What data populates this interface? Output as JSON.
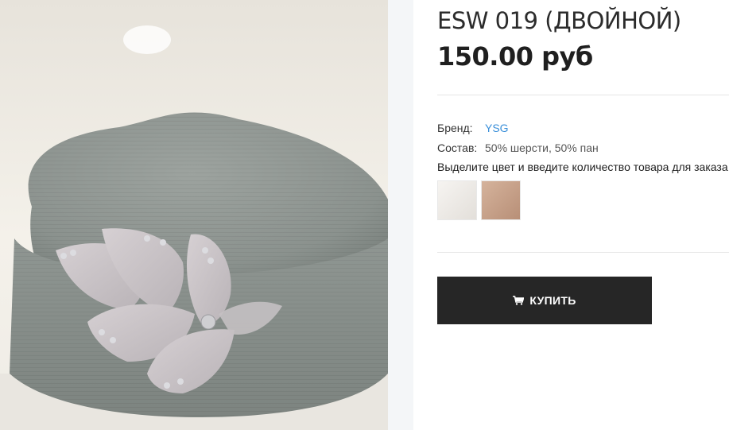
{
  "product": {
    "title": "ESW 019 (ДВОЙНОЙ)",
    "price": "150.00 руб",
    "image_alt_icon": "beret-with-felt-flower"
  },
  "meta": {
    "brand_label": "Бренд:",
    "brand_value": "YSG",
    "composition_label": "Состав:",
    "composition_value": "50% шерсти, 50% пан"
  },
  "color_hint": "Выделите цвет и введите количество товара для заказа",
  "swatches": [
    {
      "name": "white",
      "color": "#efece8"
    },
    {
      "name": "beige",
      "color": "#c9a58d"
    }
  ],
  "buy_button": {
    "label": "КУПИТЬ",
    "icon": "cart-icon"
  },
  "colors": {
    "link": "#3a8fd9",
    "button_bg": "#262626",
    "hat": "#8e9590"
  }
}
